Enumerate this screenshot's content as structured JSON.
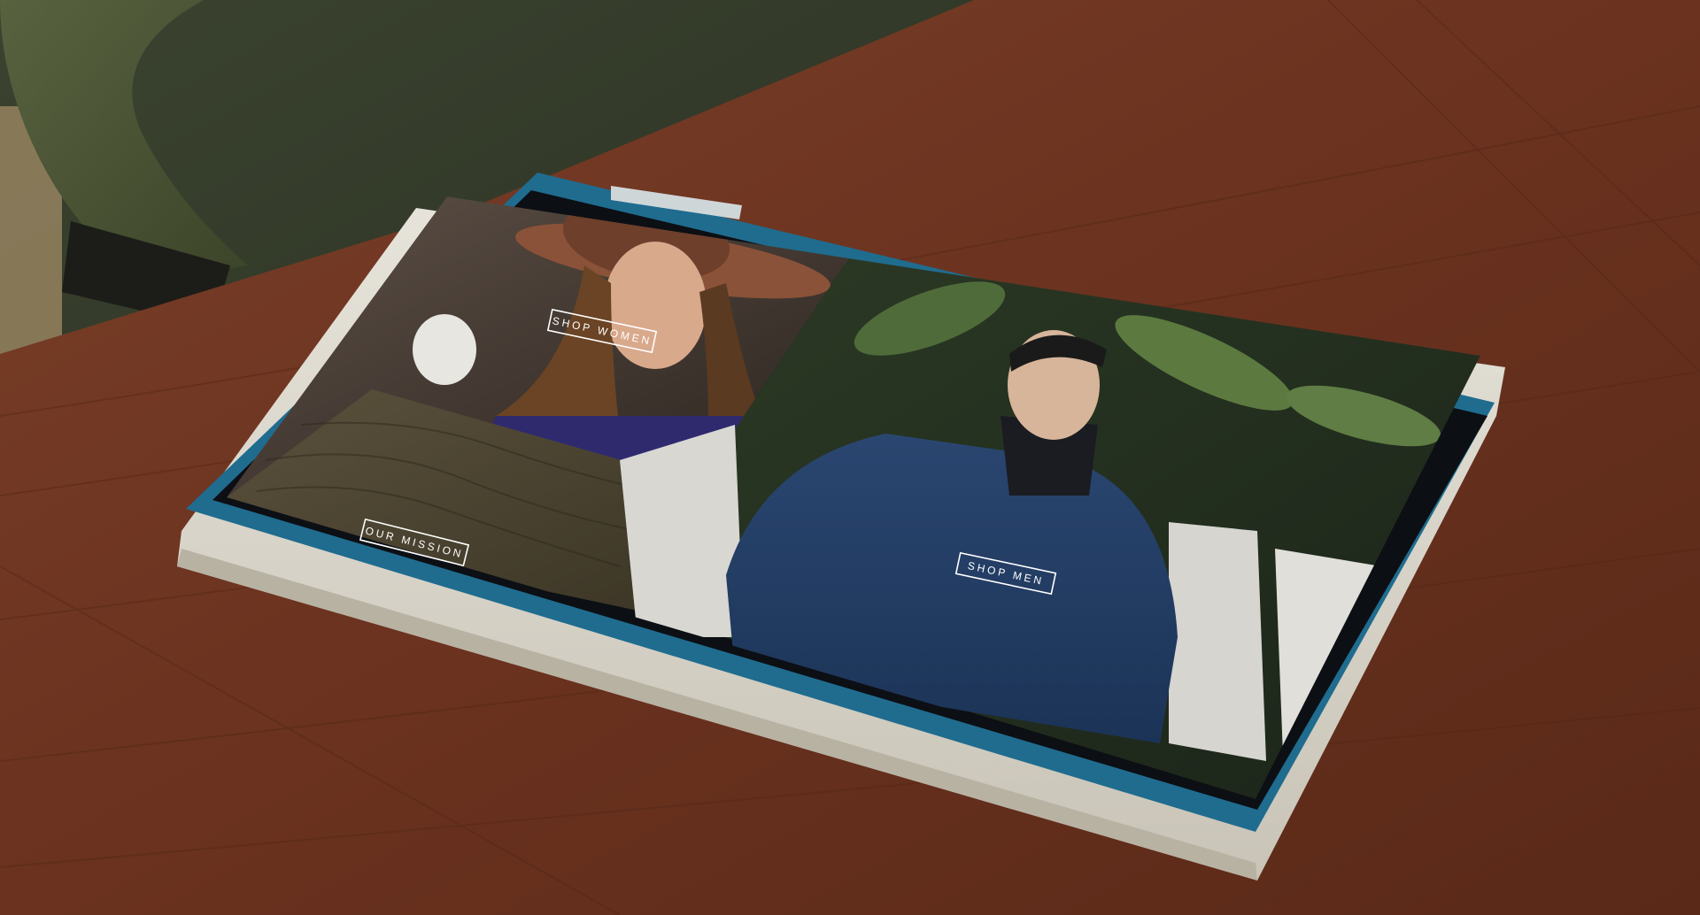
{
  "scene": {
    "wall_color": "#2e3322",
    "table_color": "#6b3522",
    "bezel_color": "#1f6c8f",
    "chassis_color": "#d9d6cc"
  },
  "screen": {
    "women_button_label": "SHOP WOMEN",
    "mission_button_label": "OUR MISSION",
    "men_button_label": "SHOP MEN"
  }
}
